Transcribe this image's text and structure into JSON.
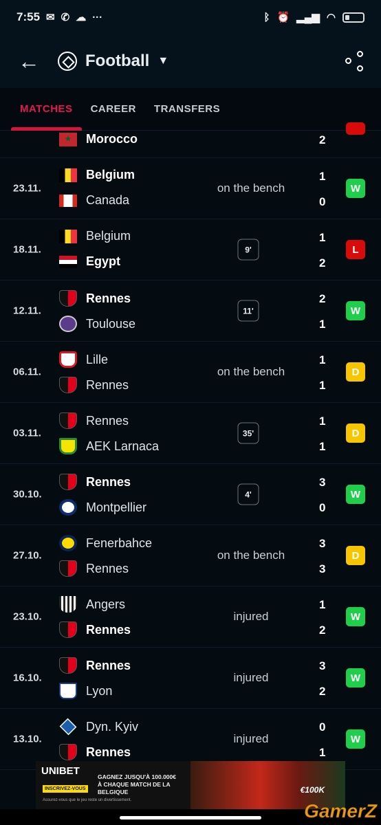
{
  "status_bar": {
    "time": "7:55",
    "more": "···"
  },
  "app_bar": {
    "title": "Football",
    "sport_icon": "football-icon"
  },
  "tabs": [
    {
      "label": "MATCHES",
      "active": true
    },
    {
      "label": "CAREER",
      "active": false
    },
    {
      "label": "TRANSFERS",
      "active": false
    }
  ],
  "colors": {
    "win": "#1fcf4c",
    "loss": "#d90a0a",
    "draw": "#f7c600",
    "accent": "#e5194f"
  },
  "partial_row": {
    "team": "Morocco",
    "logo": "f-morocco",
    "score": "2",
    "bold": true,
    "result": "L"
  },
  "matches": [
    {
      "date": "23.11.",
      "home": {
        "name": "Belgium",
        "logo": "f-belgium",
        "bold": true
      },
      "away": {
        "name": "Canada",
        "logo": "f-canada",
        "bold": false
      },
      "score": [
        "1",
        "0"
      ],
      "status": "on the bench",
      "minute": null,
      "result": "W"
    },
    {
      "date": "18.11.",
      "home": {
        "name": "Belgium",
        "logo": "f-belgium",
        "bold": false
      },
      "away": {
        "name": "Egypt",
        "logo": "f-egypt",
        "bold": true
      },
      "score": [
        "1",
        "2"
      ],
      "status": null,
      "minute": "9'",
      "result": "L"
    },
    {
      "date": "12.11.",
      "home": {
        "name": "Rennes",
        "logo": "c-rennes",
        "bold": true
      },
      "away": {
        "name": "Toulouse",
        "logo": "c-toulouse",
        "bold": false
      },
      "score": [
        "2",
        "1"
      ],
      "status": null,
      "minute": "11'",
      "result": "W"
    },
    {
      "date": "06.11.",
      "home": {
        "name": "Lille",
        "logo": "c-lille",
        "bold": false
      },
      "away": {
        "name": "Rennes",
        "logo": "c-rennes",
        "bold": false
      },
      "score": [
        "1",
        "1"
      ],
      "status": "on the bench",
      "minute": null,
      "result": "D"
    },
    {
      "date": "03.11.",
      "home": {
        "name": "Rennes",
        "logo": "c-rennes",
        "bold": false
      },
      "away": {
        "name": "AEK Larnaca",
        "logo": "c-aek",
        "bold": false
      },
      "score": [
        "1",
        "1"
      ],
      "status": null,
      "minute": "35'",
      "result": "D"
    },
    {
      "date": "30.10.",
      "home": {
        "name": "Rennes",
        "logo": "c-rennes",
        "bold": true
      },
      "away": {
        "name": "Montpellier",
        "logo": "c-montpellier",
        "bold": false
      },
      "score": [
        "3",
        "0"
      ],
      "status": null,
      "minute": "4'",
      "result": "W"
    },
    {
      "date": "27.10.",
      "home": {
        "name": "Fenerbahce",
        "logo": "c-fenerbahce",
        "bold": false
      },
      "away": {
        "name": "Rennes",
        "logo": "c-rennes",
        "bold": false
      },
      "score": [
        "3",
        "3"
      ],
      "status": "on the bench",
      "minute": null,
      "result": "D"
    },
    {
      "date": "23.10.",
      "home": {
        "name": "Angers",
        "logo": "c-angers",
        "bold": false
      },
      "away": {
        "name": "Rennes",
        "logo": "c-rennes",
        "bold": true
      },
      "score": [
        "1",
        "2"
      ],
      "status": "injured",
      "minute": null,
      "result": "W"
    },
    {
      "date": "16.10.",
      "home": {
        "name": "Rennes",
        "logo": "c-rennes",
        "bold": true
      },
      "away": {
        "name": "Lyon",
        "logo": "c-lyon",
        "bold": false
      },
      "score": [
        "3",
        "2"
      ],
      "status": "injured",
      "minute": null,
      "result": "W"
    },
    {
      "date": "13.10.",
      "home": {
        "name": "Dyn. Kyiv",
        "logo": "c-kyiv",
        "bold": false
      },
      "away": {
        "name": "Rennes",
        "logo": "c-rennes",
        "bold": true
      },
      "score": [
        "0",
        "1"
      ],
      "status": "injured",
      "minute": null,
      "result": "W"
    }
  ],
  "ad": {
    "brand": "UNIBET",
    "cta": "INSCRIVEZ-VOUS",
    "promo": "GAGNEZ JUSQU'À 100.000€ À CHAQUE MATCH DE LA BELGIQUE",
    "disclaimer": "Assurez-vous que le jeu reste un divertissement.",
    "image_text": "€100K"
  },
  "watermark": "GamerZ"
}
